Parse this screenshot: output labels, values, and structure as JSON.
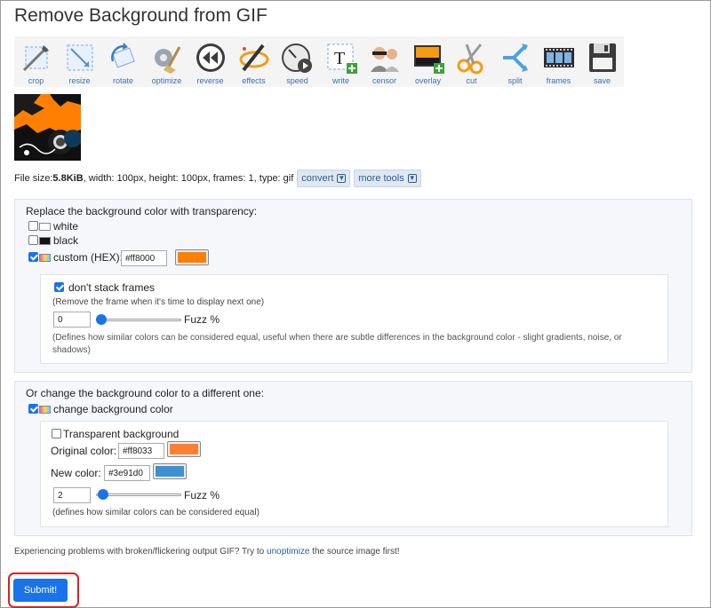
{
  "page": {
    "title": "Remove Background from GIF"
  },
  "toolbar": {
    "items": [
      {
        "label": "crop",
        "icon": "crop-icon"
      },
      {
        "label": "resize",
        "icon": "resize-icon"
      },
      {
        "label": "rotate",
        "icon": "rotate-icon"
      },
      {
        "label": "optimize",
        "icon": "optimize-icon"
      },
      {
        "label": "reverse",
        "icon": "reverse-icon"
      },
      {
        "label": "effects",
        "icon": "effects-icon"
      },
      {
        "label": "speed",
        "icon": "speed-icon"
      },
      {
        "label": "write",
        "icon": "write-icon"
      },
      {
        "label": "censor",
        "icon": "censor-icon"
      },
      {
        "label": "overlay",
        "icon": "overlay-icon"
      },
      {
        "label": "cut",
        "icon": "scissors-icon"
      },
      {
        "label": "split",
        "icon": "split-icon"
      },
      {
        "label": "frames",
        "icon": "film-icon"
      },
      {
        "label": "save",
        "icon": "save-icon"
      }
    ]
  },
  "fileinfo": {
    "size_label": "File size: ",
    "size_value": "5.8KiB",
    "details": ", width: 100px, height: 100px, frames: 1, type: gif",
    "convert_label": "convert",
    "more_tools_label": "more tools"
  },
  "replace": {
    "heading": "Replace the background color with transparency:",
    "white_label": "white",
    "white_checked": false,
    "black_label": "black",
    "black_checked": false,
    "custom_label": "custom (HEX):",
    "custom_checked": true,
    "custom_hex": "#ff8000",
    "custom_color": "#ff8000",
    "dont_stack_label": "don't stack frames",
    "dont_stack_checked": true,
    "dont_stack_note": "(Remove the frame when it's time to display next one)",
    "fuzz_value": "0",
    "fuzz_percent": 0,
    "fuzz_label": "Fuzz %",
    "fuzz_note": "(Defines how similar colors can be considered equal, useful when there are subtle differences in the background color - slight gradients, noise, or shadows)"
  },
  "change": {
    "heading": "Or change the background color to a different one:",
    "change_label": "change background color",
    "change_checked": true,
    "transparent_label": "Transparent background",
    "transparent_checked": false,
    "original_label": "Original color:",
    "original_hex": "#ff8033",
    "original_color": "#ff8033",
    "new_label": "New color:",
    "new_hex": "#3e91d0",
    "new_color": "#3e91d0",
    "fuzz_value": "2",
    "fuzz_percent": 2,
    "fuzz_label": "Fuzz %",
    "fuzz_note": "(defines how similar colors can be considered equal)"
  },
  "footer": {
    "problem_pre": "Experiencing problems with broken/flickering output GIF? Try to ",
    "problem_link": "unoptimize",
    "problem_post": " the source image first!",
    "submit_label": "Submit!"
  }
}
